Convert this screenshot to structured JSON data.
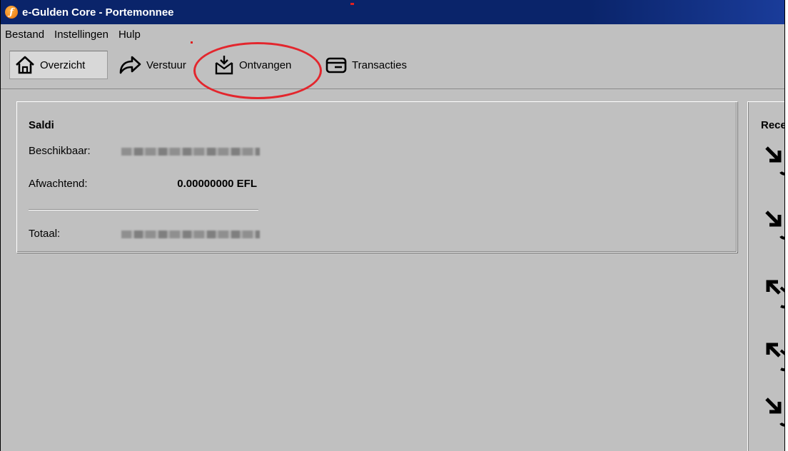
{
  "window": {
    "title": "e-Gulden Core - Portemonnee",
    "app_icon": "gulden-logo-icon",
    "accent_color": "#0a246a"
  },
  "menu": {
    "items": [
      "Bestand",
      "Instellingen",
      "Hulp"
    ]
  },
  "toolbar": {
    "tabs": [
      {
        "label": "Overzicht",
        "icon": "home-icon",
        "active": true
      },
      {
        "label": "Verstuur",
        "icon": "send-arrow-icon",
        "active": false
      },
      {
        "label": "Ontvangen",
        "icon": "receive-inbox-icon",
        "active": false
      },
      {
        "label": "Transacties",
        "icon": "wallet-card-icon",
        "active": false
      }
    ]
  },
  "annotation": {
    "type": "red-ellipse",
    "target": "Ontvangen",
    "color": "#e3262d"
  },
  "balances": {
    "title": "Saldi",
    "available_label": "Beschikbaar:",
    "pending_label": "Afwachtend:",
    "pending_value": "0.00000000 EFL",
    "total_label": "Totaal:"
  },
  "recent": {
    "title": "Rece",
    "icons": [
      "incoming-arrow-icon",
      "incoming-arrow-icon",
      "outgoing-arrow-icon",
      "outgoing-arrow-icon",
      "incoming-arrow-icon"
    ]
  }
}
